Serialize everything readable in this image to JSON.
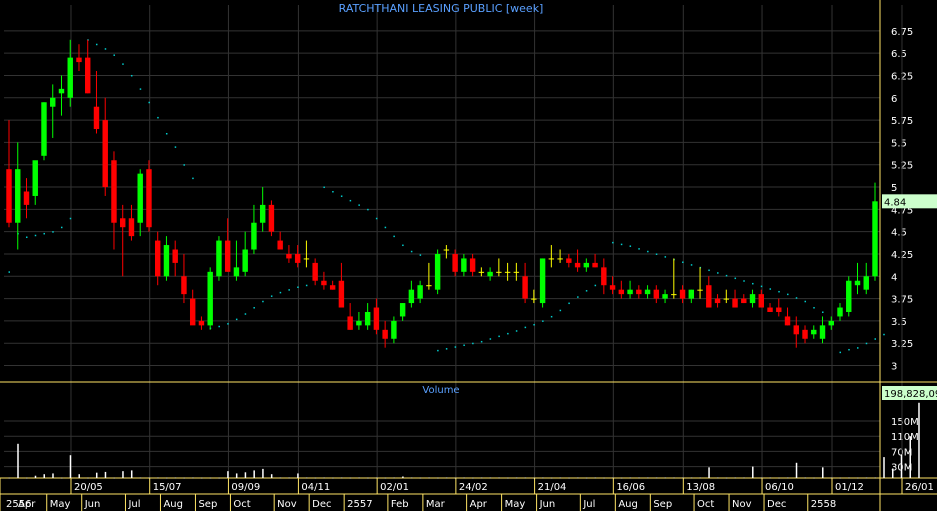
{
  "chart_data": {
    "type": "candlestick",
    "title": "RATCHTHANI LEASING PUBLIC [week]",
    "volume_label": "Volume",
    "price_axis_ticks": [
      "6.75",
      "6.5",
      "6.25",
      "6",
      "5.75",
      "5.5",
      "5.25",
      "5",
      "4.75",
      "4.5",
      "4.25",
      "4",
      "3.75",
      "3.5",
      "3.25",
      "3"
    ],
    "ylim": [
      2.95,
      6.95
    ],
    "last_price": "4.84",
    "volume_axis_ticks": [
      "150M",
      "110M",
      "70M",
      "30M"
    ],
    "volume_ylim": [
      0,
      200
    ],
    "last_volume": "198,828,09",
    "date_labels": [
      "20/05",
      "15/07",
      "09/09",
      "04/11",
      "02/01",
      "24/02",
      "21/04",
      "16/06",
      "13/08",
      "06/10",
      "01/12",
      "26/01"
    ],
    "month_labels": [
      "2556",
      "May",
      "Jun",
      "Jul",
      "Aug",
      "Sep",
      "Oct",
      "Nov",
      "Dec",
      "2557",
      "Feb",
      "Mar",
      "Apr",
      "May",
      "Jun",
      "Jul",
      "Aug",
      "Sep",
      "Oct",
      "Nov",
      "Dec",
      "2558"
    ],
    "first_month_overlay": "Apr",
    "colors": {
      "up": "#00ff00",
      "down": "#ff0000",
      "doji": "#ffff00",
      "sar": "#00cccc",
      "axis": "#ffe566",
      "grid": "#333333",
      "title": "#5aa0ff",
      "label_bg": "#ccffcc"
    },
    "candles": [
      [
        5.2,
        5.75,
        4.55,
        4.6
      ],
      [
        4.6,
        5.5,
        4.3,
        5.2
      ],
      [
        4.95,
        5.1,
        4.65,
        4.8
      ],
      [
        4.9,
        5.25,
        4.8,
        5.3
      ],
      [
        5.35,
        5.95,
        5.3,
        5.95
      ],
      [
        5.9,
        6.15,
        5.55,
        6.0
      ],
      [
        6.05,
        6.25,
        5.8,
        6.1
      ],
      [
        6.0,
        6.65,
        5.9,
        6.45
      ],
      [
        6.45,
        6.6,
        6.3,
        6.4
      ],
      [
        6.45,
        6.65,
        6.05,
        6.05
      ],
      [
        5.9,
        6.3,
        5.6,
        5.65
      ],
      [
        5.75,
        6.0,
        4.9,
        5.0
      ],
      [
        5.3,
        5.4,
        4.3,
        4.6
      ],
      [
        4.65,
        4.8,
        4.0,
        4.55
      ],
      [
        4.65,
        4.8,
        4.4,
        4.45
      ],
      [
        4.6,
        5.2,
        4.45,
        5.15
      ],
      [
        5.2,
        5.3,
        4.5,
        4.55
      ],
      [
        4.4,
        4.5,
        3.9,
        4.0
      ],
      [
        4.0,
        4.45,
        3.95,
        4.35
      ],
      [
        4.3,
        4.4,
        4.0,
        4.15
      ],
      [
        4.0,
        4.25,
        3.7,
        3.8
      ],
      [
        3.75,
        3.85,
        3.5,
        3.45
      ],
      [
        3.5,
        3.55,
        3.4,
        3.45
      ],
      [
        3.45,
        4.1,
        3.4,
        4.05
      ],
      [
        4.0,
        4.45,
        3.95,
        4.4
      ],
      [
        4.4,
        4.65,
        4.05,
        4.05
      ],
      [
        4.0,
        4.4,
        3.95,
        4.1
      ],
      [
        4.05,
        4.5,
        4.0,
        4.3
      ],
      [
        4.3,
        4.8,
        4.25,
        4.6
      ],
      [
        4.6,
        5.0,
        4.5,
        4.8
      ],
      [
        4.8,
        4.85,
        4.45,
        4.5
      ],
      [
        4.4,
        4.5,
        4.35,
        4.3
      ],
      [
        4.25,
        4.35,
        4.15,
        4.2
      ],
      [
        4.25,
        4.35,
        4.1,
        4.15
      ],
      [
        4.2,
        4.4,
        4.1,
        4.2
      ],
      [
        4.15,
        4.2,
        3.9,
        3.95
      ],
      [
        3.95,
        4.05,
        3.85,
        3.9
      ],
      [
        3.9,
        3.95,
        3.85,
        3.85
      ],
      [
        3.95,
        4.15,
        3.7,
        3.65
      ],
      [
        3.55,
        3.7,
        3.4,
        3.4
      ],
      [
        3.45,
        3.6,
        3.4,
        3.5
      ],
      [
        3.45,
        3.7,
        3.4,
        3.6
      ],
      [
        3.65,
        3.75,
        3.35,
        3.4
      ],
      [
        3.4,
        3.5,
        3.2,
        3.3
      ],
      [
        3.3,
        3.55,
        3.25,
        3.5
      ],
      [
        3.55,
        3.7,
        3.5,
        3.7
      ],
      [
        3.7,
        3.95,
        3.65,
        3.85
      ],
      [
        3.75,
        3.95,
        3.7,
        3.9
      ],
      [
        3.9,
        4.15,
        3.85,
        3.9
      ],
      [
        3.85,
        4.3,
        3.8,
        4.25
      ],
      [
        4.3,
        4.35,
        4.2,
        4.3
      ],
      [
        4.25,
        4.3,
        4.0,
        4.05
      ],
      [
        4.05,
        4.25,
        4.0,
        4.2
      ],
      [
        4.2,
        4.25,
        4.0,
        4.05
      ],
      [
        4.05,
        4.1,
        4.0,
        4.05
      ],
      [
        4.0,
        4.1,
        3.95,
        4.05
      ],
      [
        4.05,
        4.2,
        4.0,
        4.05
      ],
      [
        4.05,
        4.15,
        3.95,
        4.05
      ],
      [
        4.05,
        4.15,
        3.95,
        4.05
      ],
      [
        4.0,
        4.15,
        3.7,
        3.75
      ],
      [
        3.75,
        3.85,
        3.7,
        3.75
      ],
      [
        3.7,
        4.2,
        3.65,
        4.2
      ],
      [
        4.2,
        4.35,
        4.1,
        4.2
      ],
      [
        4.2,
        4.3,
        4.15,
        4.2
      ],
      [
        4.2,
        4.25,
        4.1,
        4.15
      ],
      [
        4.15,
        4.3,
        4.05,
        4.1
      ],
      [
        4.1,
        4.2,
        4.05,
        4.15
      ],
      [
        4.15,
        4.25,
        4.1,
        4.1
      ],
      [
        4.1,
        4.2,
        3.8,
        3.9
      ],
      [
        3.9,
        4.0,
        3.8,
        3.85
      ],
      [
        3.85,
        3.95,
        3.75,
        3.8
      ],
      [
        3.8,
        3.95,
        3.75,
        3.85
      ],
      [
        3.85,
        3.9,
        3.75,
        3.8
      ],
      [
        3.8,
        3.9,
        3.75,
        3.85
      ],
      [
        3.85,
        3.9,
        3.7,
        3.75
      ],
      [
        3.75,
        3.85,
        3.7,
        3.8
      ],
      [
        3.8,
        4.2,
        3.75,
        3.8
      ],
      [
        3.85,
        3.9,
        3.7,
        3.75
      ],
      [
        3.75,
        3.85,
        3.7,
        3.85
      ],
      [
        3.85,
        4.1,
        3.75,
        3.85
      ],
      [
        3.9,
        4.0,
        3.8,
        3.65
      ],
      [
        3.75,
        3.8,
        3.65,
        3.7
      ],
      [
        3.75,
        3.85,
        3.7,
        3.75
      ],
      [
        3.75,
        3.85,
        3.65,
        3.65
      ],
      [
        3.75,
        3.8,
        3.7,
        3.7
      ],
      [
        3.7,
        3.85,
        3.65,
        3.8
      ],
      [
        3.8,
        3.85,
        3.65,
        3.65
      ],
      [
        3.65,
        3.7,
        3.6,
        3.6
      ],
      [
        3.65,
        3.75,
        3.55,
        3.6
      ],
      [
        3.55,
        3.65,
        3.45,
        3.45
      ],
      [
        3.45,
        3.55,
        3.2,
        3.35
      ],
      [
        3.4,
        3.45,
        3.25,
        3.3
      ],
      [
        3.35,
        3.45,
        3.3,
        3.4
      ],
      [
        3.3,
        3.55,
        3.25,
        3.45
      ],
      [
        3.45,
        3.55,
        3.4,
        3.5
      ],
      [
        3.55,
        3.7,
        3.5,
        3.65
      ],
      [
        3.6,
        4.0,
        3.55,
        3.95
      ],
      [
        3.9,
        4.15,
        3.8,
        3.95
      ],
      [
        3.85,
        4.15,
        3.8,
        4.0
      ],
      [
        4.0,
        5.05,
        3.95,
        4.84
      ]
    ],
    "sar": [
      4.05,
      4.48,
      4.44,
      4.46,
      4.48,
      4.5,
      4.55,
      4.65,
      null,
      6.65,
      6.6,
      6.55,
      6.48,
      6.38,
      6.25,
      6.1,
      5.95,
      5.78,
      5.6,
      5.45,
      5.25,
      5.1,
      null,
      3.42,
      3.44,
      3.47,
      3.52,
      3.58,
      3.65,
      3.72,
      3.78,
      3.82,
      3.85,
      3.88,
      3.9,
      null,
      5.0,
      4.95,
      4.9,
      4.85,
      4.8,
      4.75,
      4.65,
      4.55,
      4.45,
      4.35,
      4.28,
      4.24,
      null,
      3.17,
      3.19,
      3.21,
      3.23,
      3.25,
      3.27,
      3.3,
      3.33,
      3.36,
      3.39,
      3.43,
      3.46,
      3.5,
      3.55,
      3.62,
      3.7,
      3.77,
      3.84,
      3.9,
      null,
      4.38,
      4.36,
      4.34,
      4.31,
      4.28,
      4.25,
      4.22,
      4.19,
      4.16,
      4.13,
      4.1,
      4.07,
      4.04,
      4.01,
      3.98,
      3.95,
      3.92,
      3.89,
      3.86,
      3.83,
      3.8,
      3.76,
      3.72,
      3.65,
      3.6,
      null,
      3.15,
      3.18,
      3.2,
      3.25,
      3.3,
      3.35
    ],
    "volume": [
      0.5,
      90,
      0.5,
      6,
      10,
      12,
      0.5,
      60,
      10,
      0.5,
      14,
      16,
      0.5,
      18,
      20,
      1,
      1,
      1,
      0.5,
      1,
      0.5,
      1,
      0.5,
      0.5,
      0.5,
      18,
      12,
      15,
      20,
      24,
      10,
      1,
      1,
      12,
      1,
      0.5,
      1,
      0.5,
      1,
      0.5,
      1,
      0.5,
      1,
      0.5,
      1,
      4,
      1,
      0.5,
      1,
      0.5,
      1,
      0.5,
      1,
      0.5,
      1,
      1,
      1,
      0.5,
      1,
      1,
      0.5,
      1,
      0.5,
      1,
      0.5,
      1,
      0.5,
      1,
      0.5,
      1,
      0.5,
      1,
      1,
      1,
      1,
      1,
      1,
      1,
      1,
      1,
      28,
      1,
      0.5,
      1,
      1,
      30,
      1,
      1,
      0.5,
      1,
      40,
      1,
      0.5,
      28,
      1,
      0.5,
      1,
      0.5,
      1,
      1,
      55,
      25,
      62,
      110,
      198
    ]
  }
}
